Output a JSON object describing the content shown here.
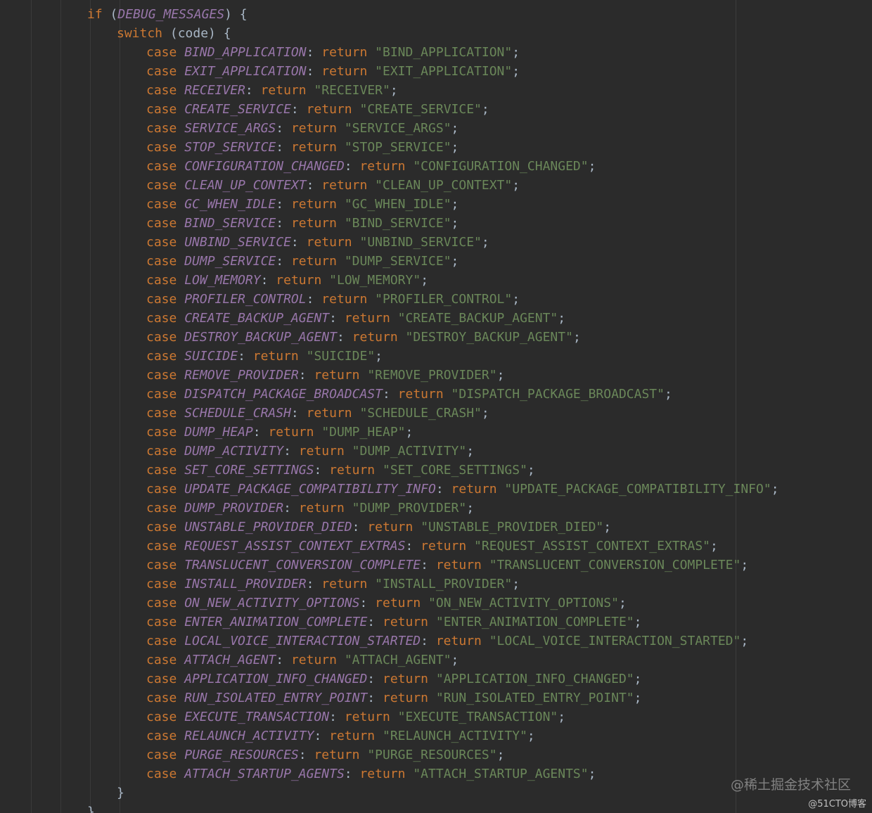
{
  "if_line": {
    "keyword": "if",
    "condition": "DEBUG_MESSAGES",
    "open": "(",
    "close": ") {"
  },
  "switch_line": {
    "keyword": "switch",
    "expression": "(code) {"
  },
  "case_keyword": "case",
  "return_keyword": "return",
  "cases": [
    {
      "constant": "BIND_APPLICATION",
      "string": "\"BIND_APPLICATION\""
    },
    {
      "constant": "EXIT_APPLICATION",
      "string": "\"EXIT_APPLICATION\""
    },
    {
      "constant": "RECEIVER",
      "string": "\"RECEIVER\""
    },
    {
      "constant": "CREATE_SERVICE",
      "string": "\"CREATE_SERVICE\""
    },
    {
      "constant": "SERVICE_ARGS",
      "string": "\"SERVICE_ARGS\""
    },
    {
      "constant": "STOP_SERVICE",
      "string": "\"STOP_SERVICE\""
    },
    {
      "constant": "CONFIGURATION_CHANGED",
      "string": "\"CONFIGURATION_CHANGED\""
    },
    {
      "constant": "CLEAN_UP_CONTEXT",
      "string": "\"CLEAN_UP_CONTEXT\""
    },
    {
      "constant": "GC_WHEN_IDLE",
      "string": "\"GC_WHEN_IDLE\""
    },
    {
      "constant": "BIND_SERVICE",
      "string": "\"BIND_SERVICE\""
    },
    {
      "constant": "UNBIND_SERVICE",
      "string": "\"UNBIND_SERVICE\""
    },
    {
      "constant": "DUMP_SERVICE",
      "string": "\"DUMP_SERVICE\""
    },
    {
      "constant": "LOW_MEMORY",
      "string": "\"LOW_MEMORY\""
    },
    {
      "constant": "PROFILER_CONTROL",
      "string": "\"PROFILER_CONTROL\""
    },
    {
      "constant": "CREATE_BACKUP_AGENT",
      "string": "\"CREATE_BACKUP_AGENT\""
    },
    {
      "constant": "DESTROY_BACKUP_AGENT",
      "string": "\"DESTROY_BACKUP_AGENT\""
    },
    {
      "constant": "SUICIDE",
      "string": "\"SUICIDE\""
    },
    {
      "constant": "REMOVE_PROVIDER",
      "string": "\"REMOVE_PROVIDER\""
    },
    {
      "constant": "DISPATCH_PACKAGE_BROADCAST",
      "string": "\"DISPATCH_PACKAGE_BROADCAST\""
    },
    {
      "constant": "SCHEDULE_CRASH",
      "string": "\"SCHEDULE_CRASH\""
    },
    {
      "constant": "DUMP_HEAP",
      "string": "\"DUMP_HEAP\""
    },
    {
      "constant": "DUMP_ACTIVITY",
      "string": "\"DUMP_ACTIVITY\""
    },
    {
      "constant": "SET_CORE_SETTINGS",
      "string": "\"SET_CORE_SETTINGS\""
    },
    {
      "constant": "UPDATE_PACKAGE_COMPATIBILITY_INFO",
      "string": "\"UPDATE_PACKAGE_COMPATIBILITY_INFO\""
    },
    {
      "constant": "DUMP_PROVIDER",
      "string": "\"DUMP_PROVIDER\""
    },
    {
      "constant": "UNSTABLE_PROVIDER_DIED",
      "string": "\"UNSTABLE_PROVIDER_DIED\""
    },
    {
      "constant": "REQUEST_ASSIST_CONTEXT_EXTRAS",
      "string": "\"REQUEST_ASSIST_CONTEXT_EXTRAS\""
    },
    {
      "constant": "TRANSLUCENT_CONVERSION_COMPLETE",
      "string": "\"TRANSLUCENT_CONVERSION_COMPLETE\""
    },
    {
      "constant": "INSTALL_PROVIDER",
      "string": "\"INSTALL_PROVIDER\""
    },
    {
      "constant": "ON_NEW_ACTIVITY_OPTIONS",
      "string": "\"ON_NEW_ACTIVITY_OPTIONS\""
    },
    {
      "constant": "ENTER_ANIMATION_COMPLETE",
      "string": "\"ENTER_ANIMATION_COMPLETE\""
    },
    {
      "constant": "LOCAL_VOICE_INTERACTION_STARTED",
      "string": "\"LOCAL_VOICE_INTERACTION_STARTED\""
    },
    {
      "constant": "ATTACH_AGENT",
      "string": "\"ATTACH_AGENT\""
    },
    {
      "constant": "APPLICATION_INFO_CHANGED",
      "string": "\"APPLICATION_INFO_CHANGED\""
    },
    {
      "constant": "RUN_ISOLATED_ENTRY_POINT",
      "string": "\"RUN_ISOLATED_ENTRY_POINT\""
    },
    {
      "constant": "EXECUTE_TRANSACTION",
      "string": "\"EXECUTE_TRANSACTION\""
    },
    {
      "constant": "RELAUNCH_ACTIVITY",
      "string": "\"RELAUNCH_ACTIVITY\""
    },
    {
      "constant": "PURGE_RESOURCES",
      "string": "\"PURGE_RESOURCES\""
    },
    {
      "constant": "ATTACH_STARTUP_AGENTS",
      "string": "\"ATTACH_STARTUP_AGENTS\""
    }
  ],
  "switch_close": "}",
  "if_close": "}",
  "watermarks": {
    "juejin": "@稀土掘金技术社区",
    "cto": "@51CTO博客"
  },
  "colors": {
    "background": "#2b2b2b",
    "keyword": "#cc7832",
    "constant": "#9876aa",
    "string": "#6a8759",
    "text": "#a9b7c6"
  }
}
